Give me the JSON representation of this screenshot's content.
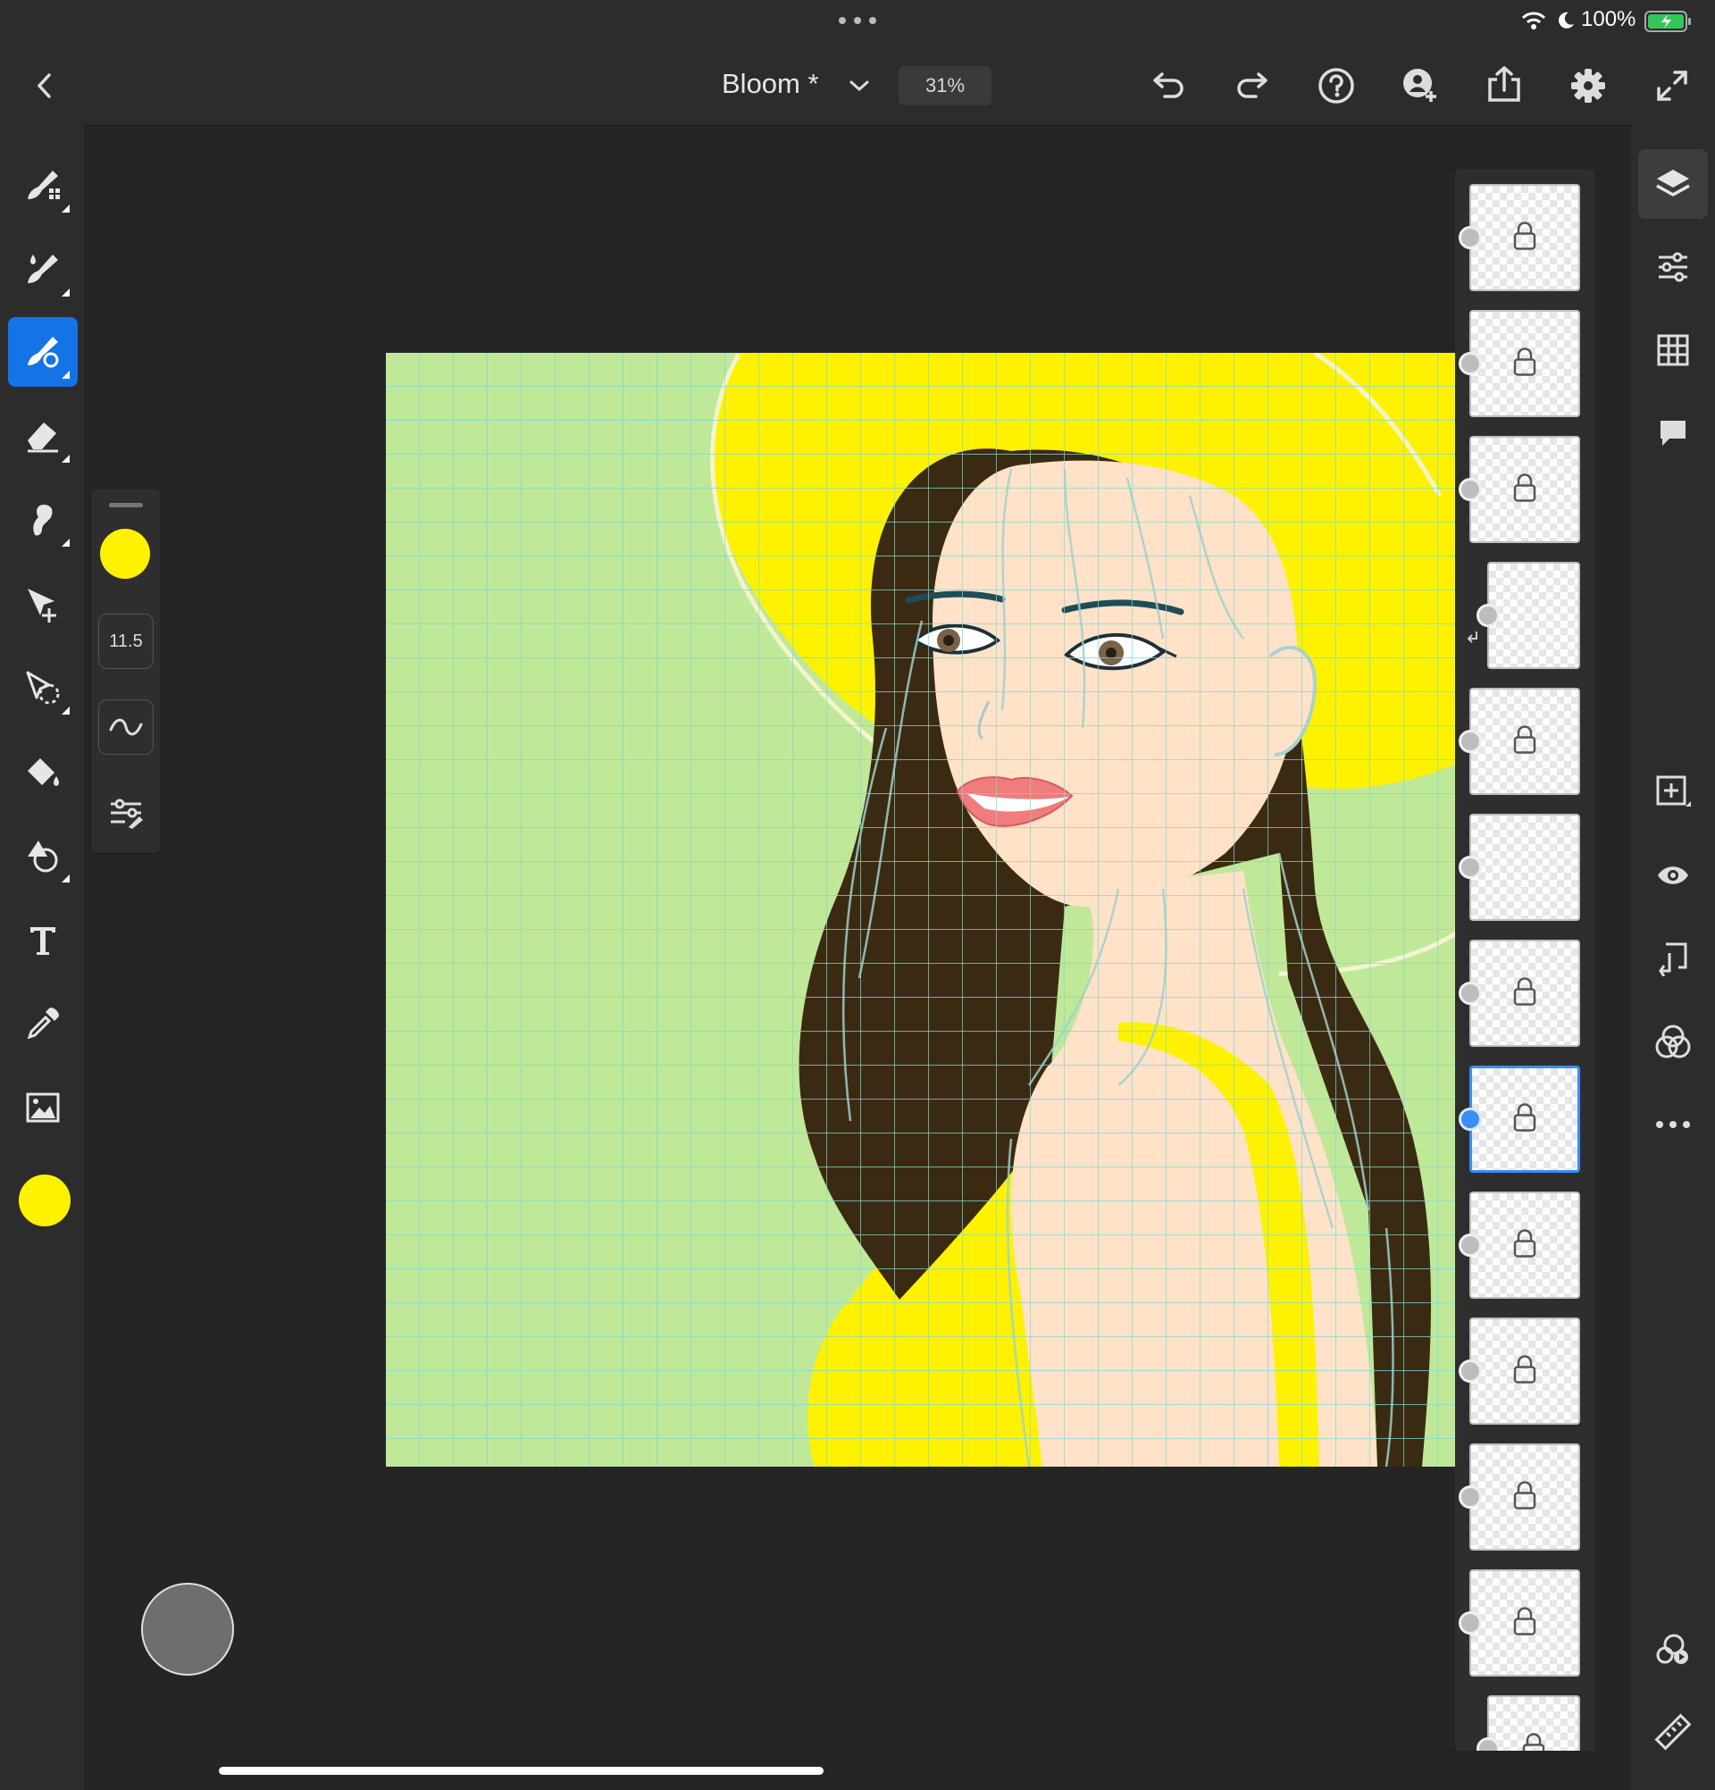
{
  "status": {
    "battery": "100%"
  },
  "header": {
    "document_title": "Bloom *",
    "zoom": "31%"
  },
  "brush": {
    "size": "11.5",
    "color": "#FFF200"
  },
  "colors": {
    "current": "#FFF200",
    "accent": "#1473E6",
    "canvas_bg": "#C0E899"
  },
  "icons": {
    "top": [
      "back-icon",
      "chevron-down-icon",
      "undo-icon",
      "redo-icon",
      "help-icon",
      "invite-icon",
      "share-icon",
      "settings-icon",
      "fullscreen-icon"
    ],
    "left": [
      "pixel-brush-icon",
      "live-brush-icon",
      "vector-brush-icon",
      "eraser-icon",
      "smudge-icon",
      "transform-icon",
      "selection-icon",
      "fill-icon",
      "shape-icon",
      "text-icon",
      "eyedropper-icon",
      "image-icon"
    ],
    "right": [
      "layers-icon",
      "layer-properties-icon",
      "grid-icon",
      "comment-icon",
      "add-layer-icon",
      "visibility-icon",
      "merge-down-icon",
      "blend-icon",
      "more-icon",
      "history-icon",
      "ruler-icon"
    ]
  },
  "layers": [
    {
      "locked": true,
      "selected": false
    },
    {
      "locked": true,
      "selected": false
    },
    {
      "locked": true,
      "selected": false
    },
    {
      "locked": false,
      "selected": false,
      "clipped": true
    },
    {
      "locked": true,
      "selected": false
    },
    {
      "locked": false,
      "selected": false
    },
    {
      "locked": true,
      "selected": false
    },
    {
      "locked": true,
      "selected": true
    },
    {
      "locked": true,
      "selected": false
    },
    {
      "locked": true,
      "selected": false
    },
    {
      "locked": true,
      "selected": false
    },
    {
      "locked": true,
      "selected": false
    },
    {
      "locked": true,
      "selected": false,
      "clipped": true
    }
  ]
}
